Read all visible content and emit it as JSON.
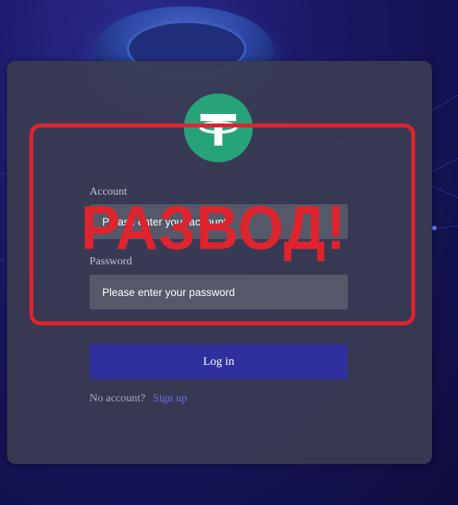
{
  "form": {
    "account_label": "Account",
    "account_placeholder": "Please enter your account",
    "password_label": "Password",
    "password_placeholder": "Please enter your password",
    "login_label": "Log in",
    "no_account_text": "No account?",
    "signup_label": "Sign up"
  },
  "stamp": {
    "text": "РАЗВОД!"
  },
  "logo": {
    "icon": "tether-logo-icon"
  },
  "colors": {
    "background": "#1c1a6a",
    "card": "#3a3c52",
    "input": "#555868",
    "button": "#2f2f9e",
    "link": "#6c6cf0",
    "logo": "#27a37a",
    "stamp": "#e0242e"
  }
}
